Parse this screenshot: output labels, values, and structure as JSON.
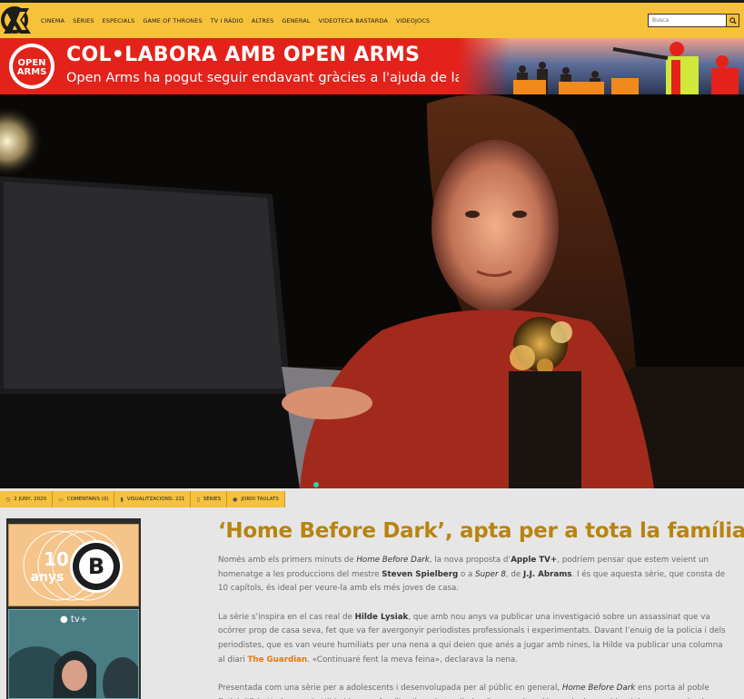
{
  "header": {
    "nav": [
      "CINEMA",
      "SÈRIES",
      "ESPECIALS",
      "GAME OF THRONES",
      "TV I RÀDIO",
      "ALTRES",
      "GENERAL",
      "VIDEOTECA BASTARDA",
      "VIDEOJOCS"
    ],
    "search_placeholder": "Busca"
  },
  "banner": {
    "logo_top": "OPEN",
    "logo_bottom": "ARMS",
    "title": "COL•LABORA AMB OPEN ARMS",
    "subtitle": "Open Arms ha pogut seguir endavant gràcies a l'ajuda de la societat civil."
  },
  "meta": {
    "date": "2 JUNY, 2020",
    "comments": "COMENTARIS (0)",
    "views": "VISUALITZACIONS: 221",
    "category": "SÈRIES",
    "author": "JORDI TAULATS"
  },
  "sidebar": {
    "ad_number": "10",
    "ad_word": "anys",
    "ad_badge": "B",
    "tv_label": "tv+"
  },
  "article": {
    "title": "‘Home Before Dark’, apta per a tota la família",
    "p1": {
      "a": "Només amb els primers minuts de ",
      "b": "Home Before Dark",
      "c": ", la nova proposta d’",
      "d": "Apple TV+",
      "e": ", podríem pensar que estem veient un homenatge a les produccions del mestre ",
      "f": "Steven Spielberg",
      "g": " o a ",
      "h": "Super 8",
      "i": ", de ",
      "j": "J.J. Abrams",
      "k": ". I és que aquesta sèrie, que consta de 10 capítols, és ideal per veure-la amb els més joves de casa."
    },
    "p2": {
      "a": "La sèrie s’inspira en el cas real de ",
      "b": "Hilde Lysiak",
      "c": ", que amb nou anys va publicar una investigació sobre un assassinat que va ocórrer prop de casa seva, fet que va  fer avergonyir periodistes professionals i experimentats. Davant l’enuig de la policia i dels periodistes, que es van veure humiliats per una nena a qui deien que anés a jugar amb nines, la Hilde va publicar una columna al diari ",
      "d": "The Guardian",
      "e": ". «Continuaré fent la meva feina», declarava la nena."
    },
    "p3": {
      "a": "Presentada com una sèrie per a adolescents i desenvolupada per al públic en general, ",
      "b": "Home Before Dark",
      "c": " ens porta al poble fictici d’Erie Harbor, on la Hilde i la seva família s’han de traslladar. Per una situació econòmica problemàtica, passen de viure en un barri gran"
    }
  },
  "colors": {
    "accent": "#f6c13b",
    "banner_red": "#e3231b",
    "title_gold": "#b88410",
    "link_orange": "#e8770a"
  }
}
